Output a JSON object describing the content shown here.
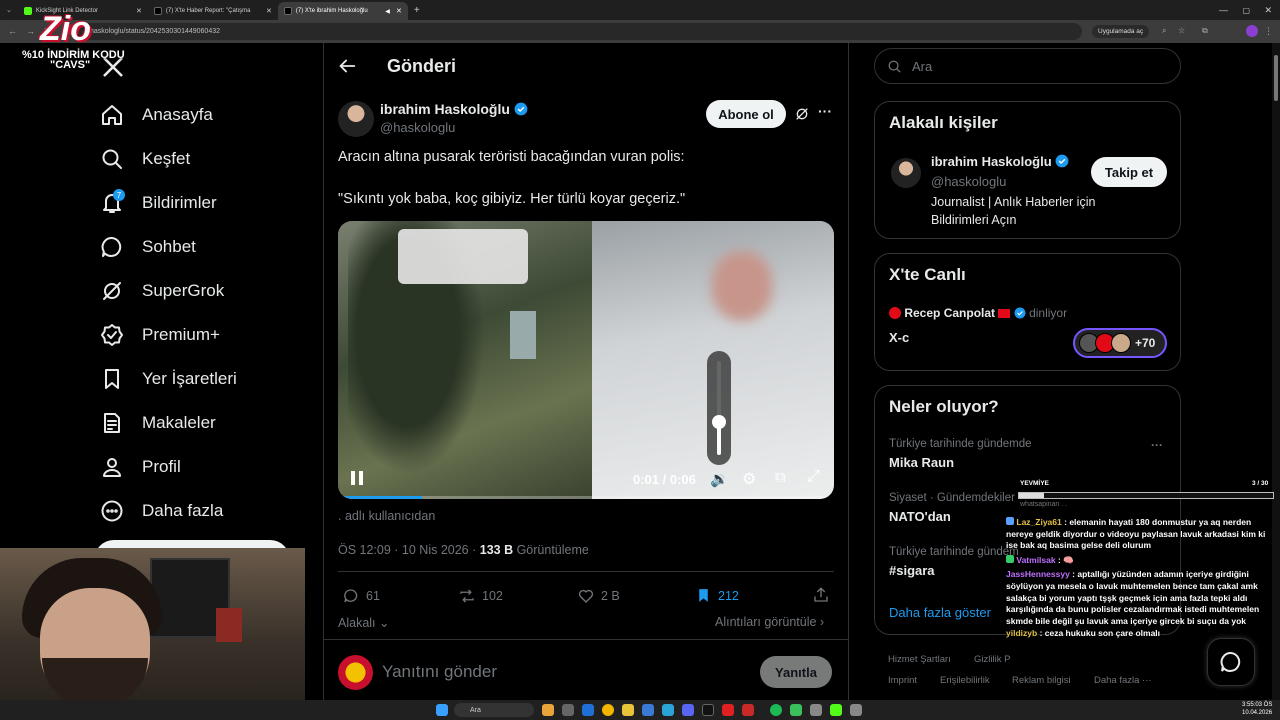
{
  "browser": {
    "tabs": [
      {
        "label": "KickSight Link Detector",
        "active": false
      },
      {
        "label": "(7) X'te Haber Report: \"Çatışma",
        "active": false
      },
      {
        "label": "(7) X'te ibrahim Haskoloğlu",
        "active": true
      }
    ],
    "url": "haskologlu/status/2042530301449060432",
    "app_chip": "Uygulamada aç"
  },
  "overlay": {
    "promo_line1": "%10 İNDİRİM KODU",
    "promo_line2": "\"CAVS\"",
    "logo_text": "Zio"
  },
  "sidebar": {
    "items": [
      {
        "label": "Anasayfa",
        "icon": "home-icon"
      },
      {
        "label": "Keşfet",
        "icon": "search-icon"
      },
      {
        "label": "Bildirimler",
        "icon": "bell-icon",
        "badge": "7"
      },
      {
        "label": "Sohbet",
        "icon": "chat-icon"
      },
      {
        "label": "SuperGrok",
        "icon": "grok-icon"
      },
      {
        "label": "Premium+",
        "icon": "verified-icon"
      },
      {
        "label": "Yer İşaretleri",
        "icon": "bookmark-icon"
      },
      {
        "label": "Makaleler",
        "icon": "article-icon"
      },
      {
        "label": "Profil",
        "icon": "person-icon"
      },
      {
        "label": "Daha fazla",
        "icon": "more-icon"
      }
    ]
  },
  "post": {
    "header": "Gönderi",
    "author_name": "ibrahim Haskoloğlu",
    "author_handle": "@haskologlu",
    "subscribe_label": "Abone ol",
    "text_line1": "Aracın altına pusarak teröristi bacağından vuran polis:",
    "text_line2": "\"Sıkıntı yok baba, koç gibiyiz. Her türlü koyar geçeriz.\"",
    "video_time": "0:01 / 0:06",
    "video_progress": 0.17,
    "volume_level": 0.35,
    "attribution": ". adlı kullanıcıdan",
    "timestamp": "ÖS 12:09 · 10 Nis 2026 · ",
    "views_count": "133 B",
    "views_label": " Görüntüleme",
    "replies": "61",
    "reposts": "102",
    "likes": "2 B",
    "bookmarks": "212",
    "related_label": "Alakalı",
    "quotes_label": "Alıntıları görüntüle",
    "reply_placeholder": "Yanıtını gönder",
    "reply_button": "Yanıtla"
  },
  "right": {
    "search_placeholder": "Ara",
    "relevant_title": "Alakalı kişiler",
    "relevant_name": "ibrahim Haskoloğlu",
    "relevant_handle": "@haskologlu",
    "relevant_bio_1": "Journalist | Anlık Haberler için",
    "relevant_bio_2": "Bildirimleri Açın",
    "follow_label": "Takip et",
    "live_title": "X'te Canlı",
    "live_host": "Recep Canpolat",
    "live_status": "dinliyor",
    "live_space": "X-c",
    "live_count": "+70",
    "trends_title": "Neler oluyor?",
    "trends": [
      {
        "context": "Türkiye tarihinde gündemde",
        "name": "Mika Raun"
      },
      {
        "context": "Siyaset · Gündemdekiler",
        "name": "NATO'dan"
      },
      {
        "context": "Türkiye tarihinde gündem",
        "name": "#sigara"
      }
    ],
    "show_more": "Daha fazla göster",
    "footer_row1": [
      "Hizmet Şartları",
      "Gizlilik P"
    ],
    "footer_row2": [
      "Imprint",
      "Erişilebilirlik",
      "Reklam bilgisi",
      "Daha fazla ···"
    ]
  },
  "stream_chat": {
    "label": "YEVMİYE",
    "counter": "3 / 30",
    "progress": 0.1,
    "partial_line": "whatsapinan . .",
    "messages": [
      {
        "user": "Laz_Ziya61",
        "text": ": elemanin hayati 180 donmustur ya aq nerden nereye geldik diyordur o videoyu paylasan lavuk arkadasi kim ki ise bak aq basima gelse deli olurum"
      },
      {
        "user": "Vatmilsak",
        "text": ": 🧠"
      },
      {
        "user": "JassHennessyy",
        "text": ": aptallığı yüzünden adamın içeriye girdiğini söylüyon ya mesela o lavuk muhtemelen bence tam çakal amk salakça bi yorum yaptı tşşk geçmek için ama fazla tepki aldı karşılığında da bunu polisler cezalandırmak istedi muhtemelen skmde bile değil şu lavuk ama içeriye gircek bi suçu da yok"
      },
      {
        "user": "yildizyb",
        "text": ": ceza hukuku son çare olmalı"
      }
    ]
  },
  "taskbar": {
    "search_placeholder": "Ara",
    "time": "3:55:03 ÖS",
    "date": "10.04.2026"
  },
  "colors": {
    "accent": "#1d9bf0",
    "bg": "#000000",
    "border": "#2f3336",
    "muted": "#71767b"
  }
}
